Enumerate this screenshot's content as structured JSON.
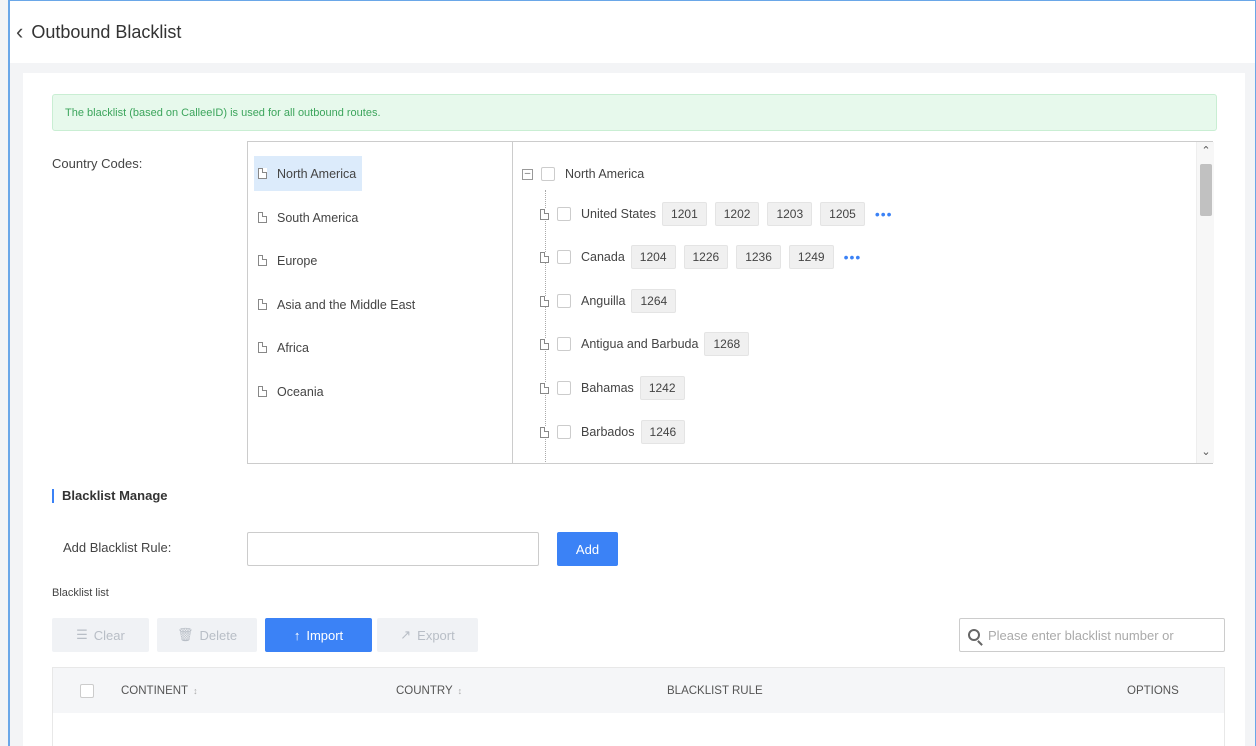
{
  "header": {
    "back_icon": "chevron-left-icon",
    "title": "Outbound Blacklist"
  },
  "notice": "The blacklist (based on CalleeID) is used for all outbound routes.",
  "country_codes": {
    "label": "Country Codes:",
    "continents": [
      "North America",
      "South America",
      "Europe",
      "Asia and the Middle East",
      "Africa",
      "Oceania"
    ],
    "selected_continent": "North America",
    "tree_root": "North America",
    "countries": [
      {
        "name": "United States",
        "codes": [
          "1201",
          "1202",
          "1203",
          "1205"
        ],
        "more": "•••"
      },
      {
        "name": "Canada",
        "codes": [
          "1204",
          "1226",
          "1236",
          "1249"
        ],
        "more": "•••"
      },
      {
        "name": "Anguilla",
        "codes": [
          "1264"
        ],
        "more": ""
      },
      {
        "name": "Antigua and Barbuda",
        "codes": [
          "1268"
        ],
        "more": ""
      },
      {
        "name": "Bahamas",
        "codes": [
          "1242"
        ],
        "more": ""
      },
      {
        "name": "Barbados",
        "codes": [
          "1246"
        ],
        "more": ""
      }
    ]
  },
  "blacklist_manage": {
    "heading": "Blacklist Manage",
    "rule_label": "Add Blacklist Rule:",
    "rule_value": "",
    "add_label": "Add",
    "list_caption": "Blacklist list"
  },
  "toolbar": {
    "clear_label": "Clear",
    "delete_label": "Delete",
    "import_label": "Import",
    "export_label": "Export",
    "search_placeholder": "Please enter blacklist number or"
  },
  "table": {
    "columns": [
      "CONTINENT",
      "COUNTRY",
      "BLACKLIST RULE",
      "OPTIONS"
    ],
    "sort_icon": "↕"
  },
  "colors": {
    "accent": "#3b82f6",
    "notice_bg": "#e7f9ec",
    "notice_text": "#3ca55c"
  }
}
